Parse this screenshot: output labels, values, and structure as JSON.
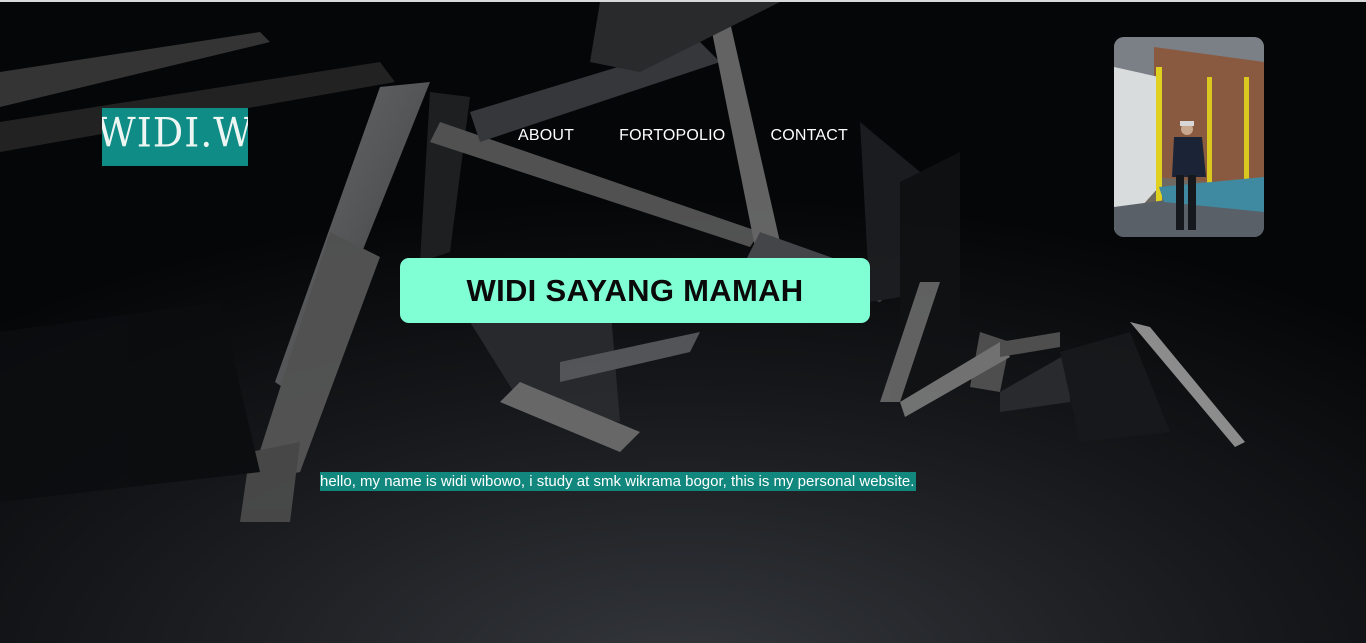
{
  "logo": {
    "text": "WIDI.W"
  },
  "nav": {
    "items": [
      {
        "label": "ABOUT"
      },
      {
        "label": "FORTOPOLIO"
      },
      {
        "label": "CONTACT"
      }
    ]
  },
  "hero": {
    "title": "WIDI SAYANG MAMAH"
  },
  "intro": {
    "text": "hello, my name is widi wibowo, i study at smk wikrama bogor, this is my personal website."
  },
  "colors": {
    "logo_bg": "#0e8c85",
    "hero_bg": "#80ffd4",
    "intro_bg": "#11877e",
    "page_bg": "#050607"
  }
}
